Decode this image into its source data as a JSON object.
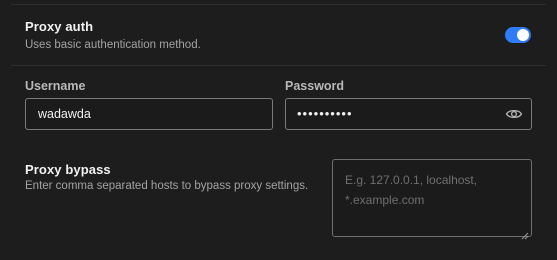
{
  "proxy_auth": {
    "title": "Proxy auth",
    "description": "Uses basic authentication method.",
    "toggle_on": true,
    "accent_color": "#2f7df6"
  },
  "username": {
    "label": "Username",
    "value": "wadawda"
  },
  "password": {
    "label": "Password",
    "masked_value": "••••••••••",
    "reveal_icon": "eye-icon"
  },
  "proxy_bypass": {
    "title": "Proxy bypass",
    "description": "Enter comma separated hosts to bypass proxy settings.",
    "placeholder_line1": "E.g. 127.0.0.1, localhost,",
    "placeholder_line2": "*.example.com"
  }
}
